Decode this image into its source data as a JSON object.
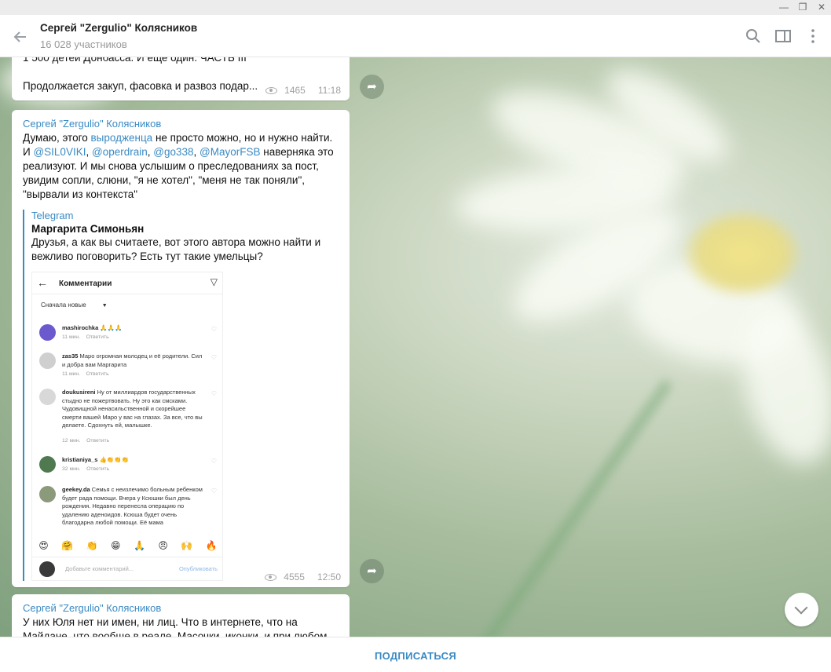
{
  "header": {
    "title": "Сергей \"Zergulio\" Колясников",
    "subtitle": "16 028 участников"
  },
  "messages": [
    {
      "text_lines": [
        "1 500 детей Донбасса. И еще один. ЧАСТЬ III",
        "",
        "Продолжается закуп, фасовка и развоз подар..."
      ],
      "views": "1465",
      "time": "11:18"
    },
    {
      "author": "Сергей \"Zergulio\" Колясников",
      "text_parts": {
        "p1": "Думаю, этого ",
        "link1": "выродженца",
        "p2": " не просто можно, но и нужно найти. И ",
        "link2": "@SIL0VIKI",
        "sep1": ", ",
        "link3": "@operdrain",
        "sep2": ", ",
        "link4": "@go338",
        "sep3": ", ",
        "link5": "@MayorFSB",
        "p3": " наверняка это реализуют. И мы снова услышим о преследованиях за пост, увидим сопли, слюни, \"я не хотел\", \"меня не так поняли\", \"вырвали из контекста\""
      },
      "quote": {
        "source": "Telegram",
        "author": "Маргарита Симоньян",
        "text": "Друзья, а как вы считаете, вот этого автора можно найти и вежливо поговорить? Есть тут такие умельцы?"
      },
      "screenshot": {
        "title": "Комментарии",
        "sort": "Сначала новые",
        "comments": [
          {
            "user": "mashirochka",
            "text": " 🙏🙏🙏",
            "time": "11 мин.",
            "reply": "Ответить",
            "avatar_color": "#6a5acd"
          },
          {
            "user": "zas35",
            "text": " Маро огромная молодец и её родители. Сил и добра вам Маргарита",
            "time": "11 мин.",
            "reply": "Ответить",
            "avatar_color": "#c8c8c8"
          },
          {
            "user": "doukusireni",
            "text": " Ну от миллиардов государственных стыдно не пожертвовать. Ну это как смсками. Чудовищной ненасильственной и скорейшее смерти вашей Маро у вас на глазах. За все, что вы делаете. Сдохнуть ей, малышке.",
            "time": "12 мин.",
            "reply": "Ответить",
            "avatar_color": "#d5d5d5"
          },
          {
            "user": "kristianiya_s",
            "text": " 👍👏👏👏",
            "time": "32 мин.",
            "reply": "Ответить",
            "avatar_color": "#4f7a4f"
          },
          {
            "user": "geekey.da",
            "text": " Семья с неизлечимо больным ребенком будет рада помощи. Вчера у Ксюшки был день рождения. Недавно перенесла операцию по удалению аденоидов. Ксюша будет очень благодарна любой помощи. Её мама",
            "time": "",
            "reply": "",
            "avatar_color": "#8a9a7a"
          }
        ],
        "emojis": [
          "😍",
          "🤗",
          "👏",
          "😁",
          "🙏",
          "😠",
          "🙌",
          "🔥"
        ],
        "input_placeholder": "Добавьте комментарий...",
        "publish": "Опубликовать"
      },
      "views": "4555",
      "time": "12:50"
    },
    {
      "author": "Сергей \"Zergulio\" Колясников",
      "text": "У них Юля нет ни имен, ни лиц. Что в интернете, что на Майдане, что вообще в реале. Масочки, иконки, и при любом"
    }
  ],
  "footer": {
    "subscribe_label": "ПОДПИСАТЬСЯ"
  },
  "icons": {
    "back": "back-arrow-icon",
    "search": "search-icon",
    "sidebar": "sidebar-toggle-icon",
    "more": "more-vertical-icon",
    "share": "share-arrow-icon",
    "views": "eye-icon",
    "scroll": "chevron-down-icon"
  },
  "colors": {
    "accent": "#3a8ac4"
  }
}
